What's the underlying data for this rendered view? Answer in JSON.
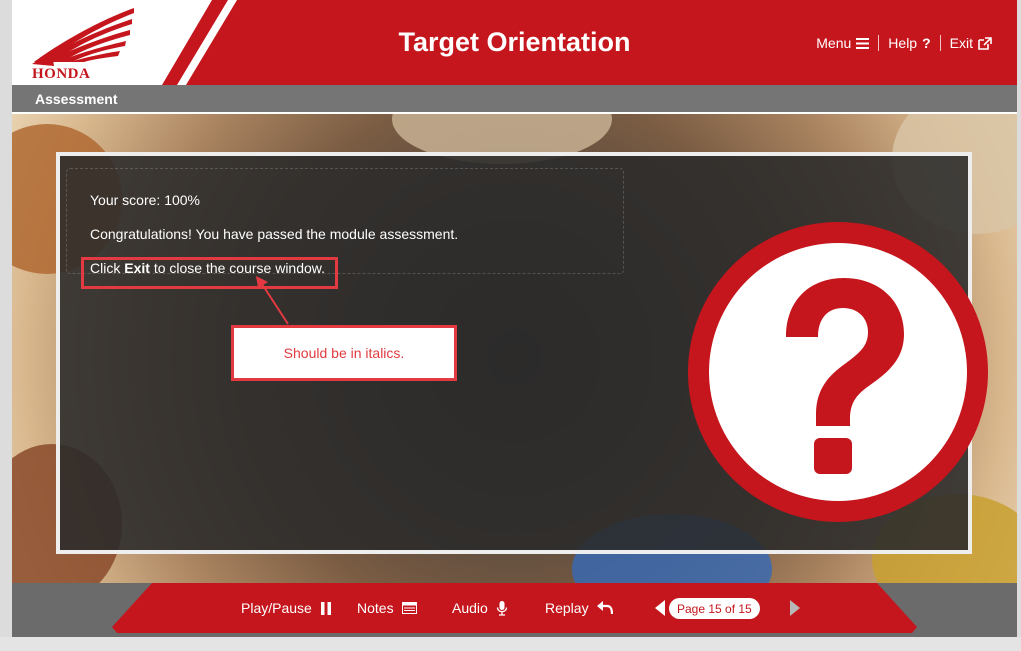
{
  "header": {
    "logo_text": "HONDA",
    "title": "Target Orientation",
    "nav": {
      "menu_label": "Menu",
      "help_label": "Help",
      "exit_label": "Exit"
    }
  },
  "section": {
    "title": "Assessment"
  },
  "content": {
    "score_text": "Your score: 100%",
    "congrats_text": "Congratulations! You have passed the module assessment.",
    "click_text": "Click",
    "exit_word": "Exit",
    "close_text": "to close the course window.",
    "callout_text": "Should be in italics."
  },
  "footer": {
    "play_pause_label": "Play/Pause",
    "notes_label": "Notes",
    "audio_label": "Audio",
    "replay_label": "Replay",
    "page_indicator": "Page 15 of 15"
  },
  "icons": {
    "menu": "hamburger-icon",
    "help": "question-icon",
    "exit": "external-link-icon",
    "play_pause": "pause-icon",
    "notes": "notes-icon",
    "audio": "microphone-icon",
    "replay": "reply-arrow-icon",
    "prev": "triangle-left-icon",
    "next": "triangle-right-icon",
    "content": "question-mark-icon"
  },
  "colors": {
    "brand_red": "#c4161c",
    "annotation_red": "#e23a40",
    "section_gray": "#757575"
  }
}
